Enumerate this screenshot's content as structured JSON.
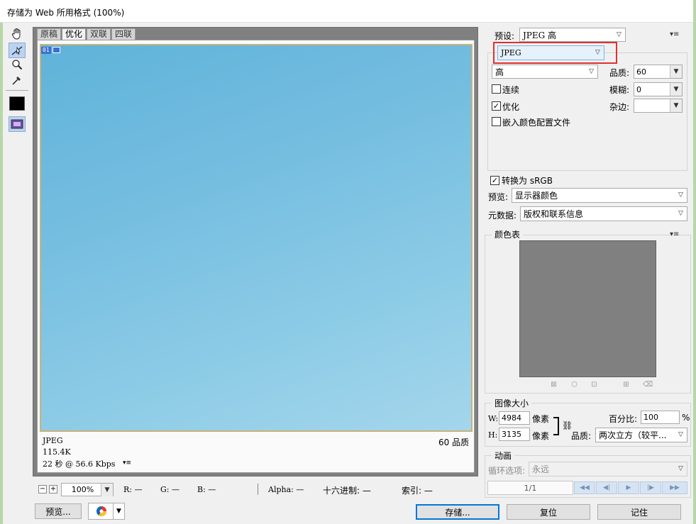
{
  "window": {
    "title": "存储为 Web 所用格式 (100%)"
  },
  "toolbox": {
    "tools": [
      {
        "name": "hand-tool",
        "icon": "hand-icon"
      },
      {
        "name": "slice-select-tool",
        "icon": "slice-select-icon"
      },
      {
        "name": "zoom-tool",
        "icon": "magnifier-icon"
      },
      {
        "name": "eyedropper-tool",
        "icon": "eyedropper-icon"
      }
    ],
    "eyedropper_color": "#000000"
  },
  "preview": {
    "tabs": [
      "原稿",
      "优化",
      "双联",
      "四联"
    ],
    "active_tab": "优化",
    "slice_number": "01",
    "info": {
      "format": "JPEG",
      "size": "115.4K",
      "time": "22 秒 @ 56.6 Kbps",
      "quality": "60 品质"
    }
  },
  "status_bar": {
    "zoom_minus": "−",
    "zoom_plus": "+",
    "zoom_value": "100%",
    "r": "R: —",
    "g": "G: —",
    "b": "B: —",
    "alpha": "Alpha: —",
    "hex": "十六进制: —",
    "index": "索引: —"
  },
  "bottom_buttons": {
    "preview": "预览...",
    "save": "存储...",
    "reset": "复位",
    "remember": "记住"
  },
  "settings": {
    "preset_label": "预设:",
    "preset_value": "JPEG 高",
    "format_value": "JPEG",
    "compression_value": "高",
    "quality_label": "品质:",
    "quality_value": "60",
    "progressive_label": "连续",
    "progressive_checked": false,
    "blur_label": "模糊:",
    "blur_value": "0",
    "optimized_label": "优化",
    "optimized_checked": true,
    "matte_label": "杂边:",
    "matte_value": "",
    "embed_profile_label": "嵌入颜色配置文件",
    "embed_profile_checked": false,
    "convert_srgb_label": "转换为 sRGB",
    "convert_srgb_checked": true,
    "preview_label": "预览:",
    "preview_value": "显示器颜色",
    "metadata_label": "元数据:",
    "metadata_value": "版权和联系信息"
  },
  "color_table": {
    "title": "颜色表",
    "swatch_color": "#808080"
  },
  "image_size": {
    "title": "图像大小",
    "w_label": "W:",
    "w_value": "4984",
    "h_label": "H:",
    "h_value": "3135",
    "unit": "像素",
    "percent_label": "百分比:",
    "percent_value": "100",
    "percent_unit": "%",
    "quality_label": "品质:",
    "quality_value": "两次立方（较平..."
  },
  "animation": {
    "title": "动画",
    "loop_label": "循环选项:",
    "loop_value": "永远",
    "frame_counter": "1/1"
  }
}
